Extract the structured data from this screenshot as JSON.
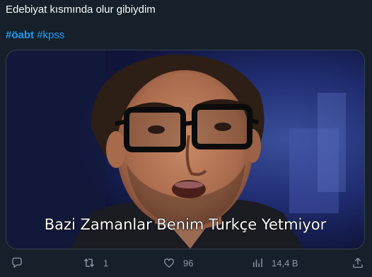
{
  "tweet": {
    "text": "Edebiyat kısmında olur gibiydim",
    "hashtags": [
      "#öabt",
      "#kpss"
    ]
  },
  "media": {
    "caption": "Bazi Zamanlar Benim Turkçe Yetmiyor"
  },
  "actions": {
    "reply": {
      "icon": "reply-icon",
      "count": ""
    },
    "retweet": {
      "icon": "retweet-icon",
      "count": "1"
    },
    "like": {
      "icon": "heart-icon",
      "count": "96"
    },
    "views": {
      "icon": "analytics-icon",
      "count": "14,4 B"
    },
    "share": {
      "icon": "share-icon"
    }
  },
  "colors": {
    "background": "#15202b",
    "text": "#f7f9f9",
    "link": "#1d9bf0",
    "muted": "#8b98a5"
  }
}
